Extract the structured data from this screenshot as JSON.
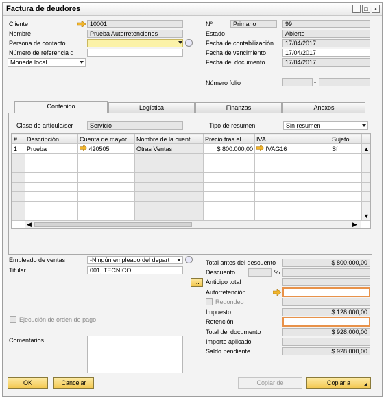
{
  "window": {
    "title": "Factura de deudores"
  },
  "header_left": {
    "cliente_label": "Cliente",
    "cliente_value": "10001",
    "nombre_label": "Nombre",
    "nombre_value": "Prueba Autorretenciones",
    "persona_label": "Persona de contacto",
    "persona_value": "",
    "numref_label": "Número de referencia d",
    "numref_value": "",
    "moneda_value": "Moneda local"
  },
  "header_right": {
    "no_label": "Nº",
    "serie_value": "Primario",
    "no_value": "99",
    "estado_label": "Estado",
    "estado_value": "Abierto",
    "fcont_label": "Fecha de contabilización",
    "fcont_value": "17/04/2017",
    "fvenc_label": "Fecha de vencimiento",
    "fvenc_value": "17/04/2017",
    "fdoc_label": "Fecha del documento",
    "fdoc_value": "17/04/2017",
    "folio_label": "Número folio",
    "folio_sep": "-"
  },
  "tabs": [
    "Contenido",
    "Logística",
    "Finanzas",
    "Anexos"
  ],
  "contenido": {
    "clase_label": "Clase de artículo/ser",
    "clase_value": "Servicio",
    "tipo_label": "Tipo de resumen",
    "tipo_value": "Sin resumen",
    "columns": [
      "#",
      "Descripción",
      "Cuenta de mayor",
      "Nombre de la cuent...",
      "Precio tras el ...",
      "IVA",
      "Sujeto..."
    ],
    "rows": [
      {
        "n": "1",
        "desc": "Prueba",
        "cuenta": "420505",
        "nombre": "Otras Ventas",
        "precio": "$ 800.000,00",
        "iva": "IVAG16",
        "sujeto": "Sí"
      }
    ]
  },
  "bottom_left": {
    "empleado_label": "Empleado de ventas",
    "empleado_value": "-Ningún empleado del depart",
    "titular_label": "Titular",
    "titular_value": "001, TECNICO",
    "ejecucion_label": "Ejecución de orden de pago",
    "comentarios_label": "Comentarios"
  },
  "totals": {
    "total_antes_label": "Total antes del descuento",
    "total_antes_value": "$ 800.000,00",
    "descuento_label": "Descuento",
    "descuento_pct": "%",
    "anticipo_label": "Anticipo total",
    "anticipo_btn": "...",
    "autorretencion_label": "Autorretención",
    "redondeo_label": "Redondeo",
    "impuesto_label": "Impuesto",
    "impuesto_value": "$ 128.000,00",
    "retencion_label": "Retención",
    "total_doc_label": "Total del documento",
    "total_doc_value": "$ 928.000,00",
    "importe_label": "Importe aplicado",
    "saldo_label": "Saldo pendiente",
    "saldo_value": "$ 928.000,00"
  },
  "buttons": {
    "ok": "OK",
    "cancelar": "Cancelar",
    "copiar_de": "Copiar de",
    "copiar_a": "Copiar a"
  },
  "icons": {
    "link_arrow": "arrow-right-icon",
    "info": "info-icon"
  },
  "colors": {
    "accent_orange": "#e8924a",
    "yellow_field": "#fbf2a8",
    "button_gold": "#f3c74e",
    "arrow_yellow": "#f1b52b"
  }
}
